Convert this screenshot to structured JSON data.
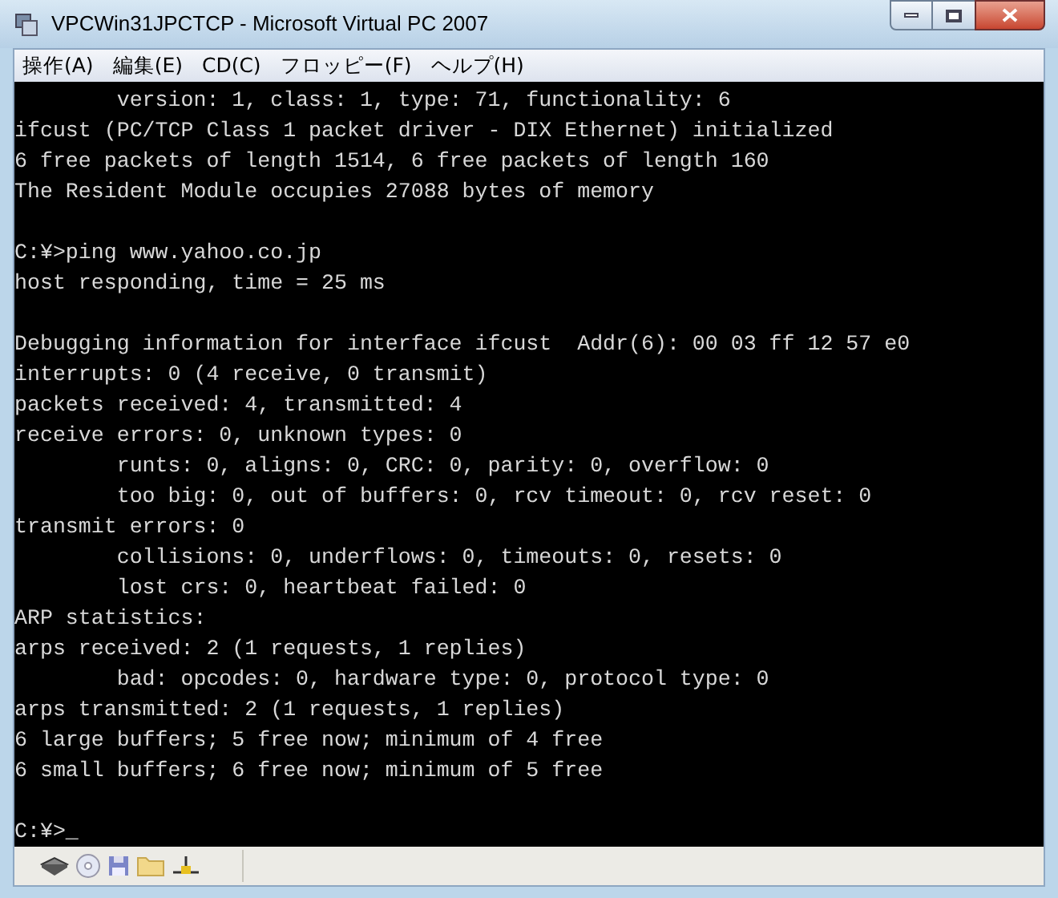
{
  "window": {
    "title": "VPCWin31JPCTCP - Microsoft Virtual PC 2007"
  },
  "menu": [
    "操作(A)",
    "編集(E)",
    "CD(C)",
    "フロッピー(F)",
    "ヘルプ(H)"
  ],
  "console": {
    "blocks": [
      [
        "        version: 1, class: 1, type: 71, functionality: 6",
        "ifcust (PC/TCP Class 1 packet driver - DIX Ethernet) initialized",
        "6 free packets of length 1514, 6 free packets of length 160",
        "The Resident Module occupies 27088 bytes of memory"
      ],
      [
        "C:¥>ping www.yahoo.co.jp",
        "host responding, time = 25 ms"
      ],
      [
        "Debugging information for interface ifcust  Addr(6): 00 03 ff 12 57 e0",
        "interrupts: 0 (4 receive, 0 transmit)",
        "packets received: 4, transmitted: 4",
        "receive errors: 0, unknown types: 0",
        "        runts: 0, aligns: 0, CRC: 0, parity: 0, overflow: 0",
        "        too big: 0, out of buffers: 0, rcv timeout: 0, rcv reset: 0",
        "transmit errors: 0",
        "        collisions: 0, underflows: 0, timeouts: 0, resets: 0",
        "        lost crs: 0, heartbeat failed: 0",
        "ARP statistics:",
        "arps received: 2 (1 requests, 1 replies)",
        "        bad: opcodes: 0, hardware type: 0, protocol type: 0",
        "arps transmitted: 2 (1 requests, 1 replies)",
        "6 large buffers; 5 free now; minimum of 4 free",
        "6 small buffers; 6 free now; minimum of 5 free"
      ],
      [
        "C:¥>_"
      ]
    ]
  }
}
